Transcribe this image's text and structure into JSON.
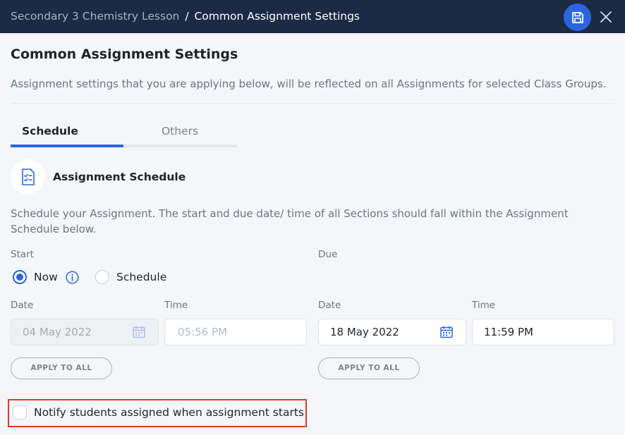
{
  "header": {
    "breadcrumb_parent": "Secondary 3 Chemistry Lesson",
    "breadcrumb_separator": "/",
    "breadcrumb_current": "Common Assignment Settings",
    "save_icon": "save-icon",
    "close_icon": "close-icon"
  },
  "page": {
    "title": "Common Assignment Settings",
    "description": "Assignment settings that you are applying below, will be reflected on all Assignments for selected Class Groups."
  },
  "tabs": [
    {
      "label": "Schedule",
      "active": true
    },
    {
      "label": "Others",
      "active": false
    }
  ],
  "schedule": {
    "icon": "checklist-document-icon",
    "title": "Assignment Schedule",
    "description": "Schedule your Assignment. The start and due date/ time of all Sections should fall within the Assignment Schedule below."
  },
  "start": {
    "label": "Start",
    "options": [
      {
        "label": "Now",
        "selected": true
      },
      {
        "label": "Schedule",
        "selected": false
      }
    ],
    "date_label": "Date",
    "date_value": "04 May 2022",
    "time_label": "Time",
    "time_value": "05:56 PM",
    "apply_label": "APPLY TO ALL",
    "disabled": true
  },
  "due": {
    "label": "Due",
    "date_label": "Date",
    "date_value": "18 May 2022",
    "time_label": "Time",
    "time_value": "11:59 PM",
    "apply_label": "APPLY TO ALL"
  },
  "notify": {
    "label": "Notify students assigned when assignment starts",
    "checked": false
  },
  "colors": {
    "header_bg": "#1b2b45",
    "accent": "#2c64e0",
    "highlight_border": "#e03b24",
    "page_bg": "#f4f6f9"
  }
}
